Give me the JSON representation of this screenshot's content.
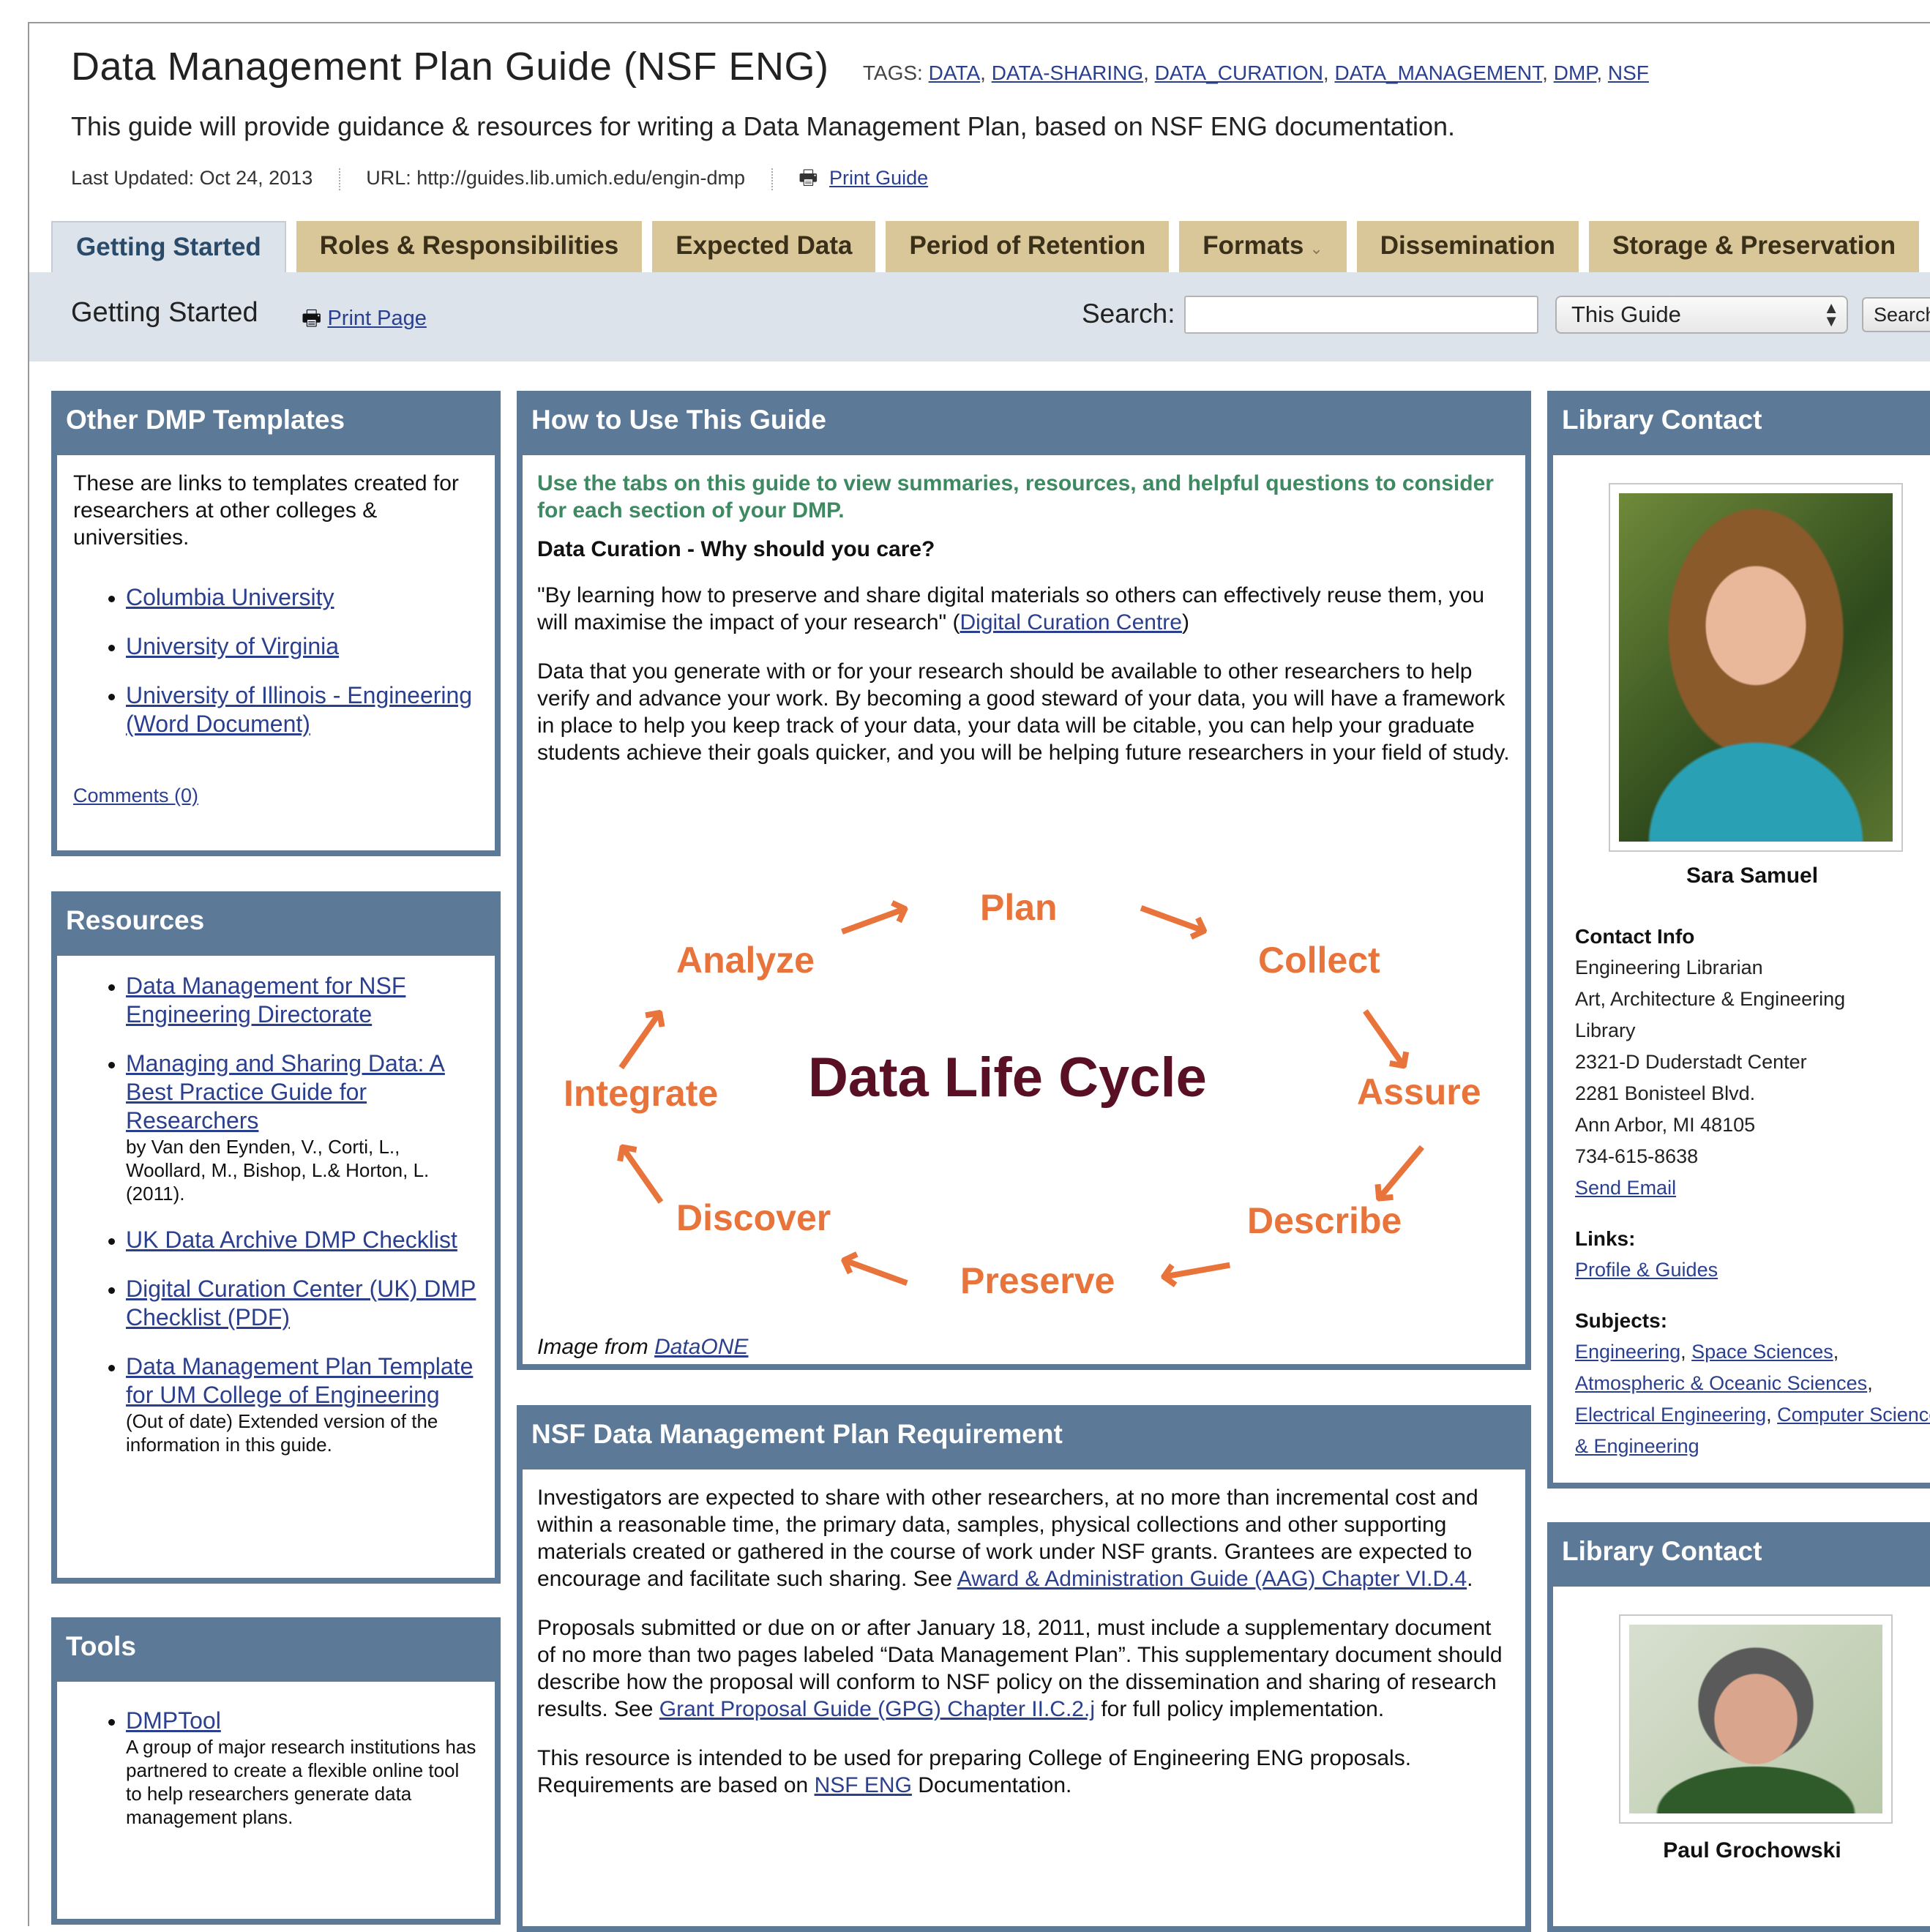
{
  "guide": {
    "title": "Data Management Plan Guide (NSF ENG)",
    "tags_label": "TAGS:",
    "tags": [
      "DATA",
      "DATA-SHARING",
      "DATA_CURATION",
      "DATA_MANAGEMENT",
      "DMP",
      "NSF"
    ],
    "description": "This guide will provide guidance & resources for writing a Data Management Plan, based on NSF ENG documentation.",
    "last_updated": "Last Updated: Oct 24, 2013",
    "url": "URL: http://guides.lib.umich.edu/engin-dmp",
    "print_guide": "Print Guide"
  },
  "tabs": [
    {
      "label": "Getting Started",
      "active": true
    },
    {
      "label": "Roles & Responsibilities"
    },
    {
      "label": "Expected Data"
    },
    {
      "label": "Period of Retention"
    },
    {
      "label": "Formats",
      "dropdown": true
    },
    {
      "label": "Dissemination"
    },
    {
      "label": "Storage & Preservation"
    }
  ],
  "subbar": {
    "page_title": "Getting Started",
    "print_page": "Print Page",
    "search_label": "Search:",
    "search_value": "",
    "scope_value": "This Guide",
    "search_button": "Search"
  },
  "templates_box": {
    "heading": "Other DMP Templates",
    "intro": "These are links to templates created for researchers at other colleges & universities.",
    "links": [
      "Columbia University",
      "University of Virginia",
      "University of Illinois - Engineering (Word Document)"
    ],
    "comments": "Comments (0)"
  },
  "resources_box": {
    "heading": "Resources",
    "items": [
      {
        "link": "Data Management for NSF Engineering Directorate",
        "note": ""
      },
      {
        "link": "Managing and Sharing Data: A Best Practice Guide for Researchers",
        "note": "by Van den Eynden, V., Corti, L., Woollard, M., Bishop, L.& Horton, L. (2011)."
      },
      {
        "link": "UK Data Archive DMP Checklist",
        "note": ""
      },
      {
        "link": "Digital Curation Center (UK) DMP Checklist (PDF)",
        "note": ""
      },
      {
        "link": "Data Management Plan Template for UM College of Engineering",
        "note": "(Out of date) Extended version of the information in this guide."
      }
    ]
  },
  "tools_box": {
    "heading": "Tools",
    "items": [
      {
        "link": "DMPTool",
        "note": "A group of major research institutions has partnered to create a flexible online tool to help researchers generate data management plans."
      }
    ]
  },
  "howto_box": {
    "heading": "How to Use This Guide",
    "lead": "Use the tabs on this guide to view summaries, resources, and helpful questions to consider for each section of your DMP.",
    "subheading": "Data Curation - Why should you care?",
    "quote": "\"By learning how to preserve and share digital materials so others can effectively reuse them, you will maximise the impact of your research\" (",
    "quote_link": "Digital Curation Centre",
    "quote_end": ")",
    "body": "Data that you generate with or for your research should be available to other researchers to help verify and advance your work. By becoming a good steward of your data, you will have a framework in place to help you keep track of your data, your data will be citable, you can help your graduate students achieve their goals quicker, and you will be helping future researchers in your field of study.",
    "lifecycle": {
      "center": "Data Life Cycle",
      "stages": [
        "Plan",
        "Collect",
        "Assure",
        "Describe",
        "Preserve",
        "Discover",
        "Integrate",
        "Analyze"
      ]
    },
    "image_credit": "Image from ",
    "image_credit_link": "DataONE"
  },
  "nsf_box": {
    "heading": "NSF Data Management Plan Requirement",
    "p1": "Investigators are expected to share with other researchers, at no more than incremental cost and within a reasonable time, the primary data, samples, physical collections and other supporting materials created or gathered in the course of work under NSF grants. Grantees are expected to encourage and facilitate such sharing. See ",
    "p1_link": "Award & Administration Guide (AAG) Chapter VI.D.4",
    "p1_end": ".",
    "p2": "Proposals submitted or due on or after January 18, 2011, must include a supplementary document of no more than two pages labeled “Data Management Plan”. This supplementary document should describe how the proposal will conform to NSF policy on the dissemination and sharing of research results. See ",
    "p2_link": "Grant Proposal Guide (GPG) Chapter II.C.2.j",
    "p2_end": " for full policy implementation.",
    "p3": "This resource is intended to be used for preparing College of Engineering ENG proposals. Requirements are based on ",
    "p3_link": "NSF ENG",
    "p3_end": " Documentation."
  },
  "contact1": {
    "heading": "Library Contact",
    "name": "Sara Samuel",
    "contact_info_label": "Contact Info",
    "lines": [
      "Engineering Librarian",
      "Art, Architecture & Engineering",
      "Library",
      "2321-D Duderstadt Center",
      "2281 Bonisteel Blvd.",
      "Ann Arbor, MI 48105",
      "734-615-8638"
    ],
    "send_email": "Send Email",
    "links_label": "Links:",
    "profile_link": "Profile & Guides",
    "subjects_label": "Subjects:",
    "subjects": [
      "Engineering",
      "Space Sciences",
      "Atmospheric & Oceanic Sciences",
      "Electrical Engineering",
      "Computer Science & Engineering"
    ]
  },
  "contact2": {
    "heading": "Library Contact",
    "name": "Paul Grochowski"
  },
  "icons": {
    "printer": "printer-icon",
    "dropdown": "chevron-down-icon",
    "select": "updown-arrows-icon"
  },
  "colors": {
    "box_header": "#5c7a97",
    "tab": "#d9c79a",
    "lifecycle": "#e8743b",
    "lead_text": "#3d8a62",
    "link": "#2b3f8f"
  }
}
